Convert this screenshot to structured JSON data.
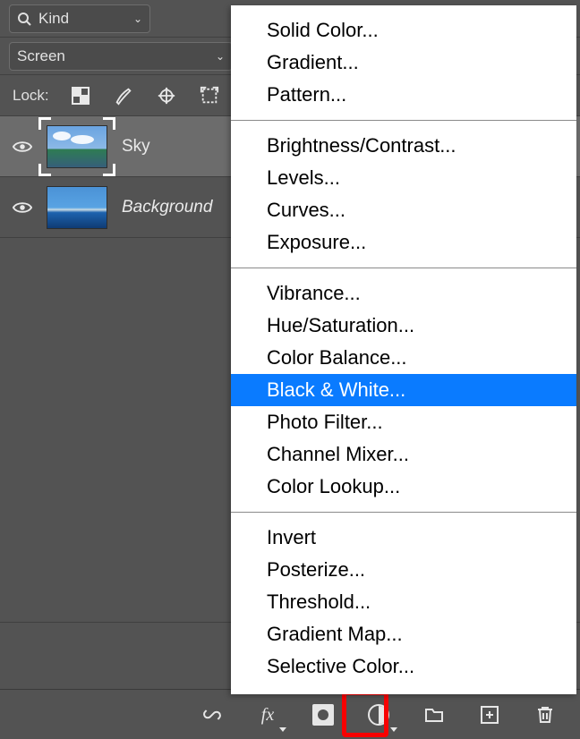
{
  "filter": {
    "label": "Kind"
  },
  "blend": {
    "label": "Screen"
  },
  "lock": {
    "label": "Lock:"
  },
  "layers": [
    {
      "name": "Sky",
      "selected": true,
      "visible": true,
      "thumb": "sky"
    },
    {
      "name": "Background",
      "selected": false,
      "visible": true,
      "thumb": "bg",
      "italic": true
    }
  ],
  "menu": {
    "groups": [
      [
        "Solid Color...",
        "Gradient...",
        "Pattern..."
      ],
      [
        "Brightness/Contrast...",
        "Levels...",
        "Curves...",
        "Exposure..."
      ],
      [
        "Vibrance...",
        "Hue/Saturation...",
        "Color Balance...",
        "Black & White...",
        "Photo Filter...",
        "Channel Mixer...",
        "Color Lookup..."
      ],
      [
        "Invert",
        "Posterize...",
        "Threshold...",
        "Gradient Map...",
        "Selective Color..."
      ]
    ],
    "selected": "Black & White..."
  }
}
